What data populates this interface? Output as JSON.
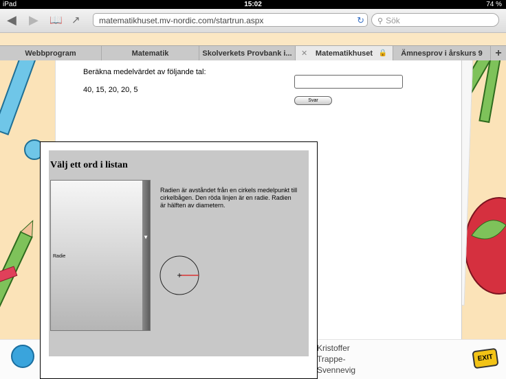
{
  "status": {
    "device": "iPad",
    "time": "15:02",
    "battery": "74 %"
  },
  "browser": {
    "url": "matematikhuset.mv-nordic.com/startrun.aspx",
    "search_placeholder": "Sök",
    "tabs": [
      {
        "label": "Webbprogram"
      },
      {
        "label": "Matematik"
      },
      {
        "label": "Skolverkets Provbank i..."
      },
      {
        "label": "Matematikhuset"
      },
      {
        "label": "Ämnesprov i årskurs 9"
      }
    ]
  },
  "exercise": {
    "question": "Beräkna medelvärdet av följande tal:",
    "numbers": "40, 15, 20, 20, 5",
    "answer_value": "",
    "answer_button": "Svar"
  },
  "popup": {
    "title": "Välj ett ord i listan",
    "list_items": [
      "Radie"
    ],
    "explanation": "Radien är avståndet från en cirkels medelpunkt till cirkelbågen. Den röda linjen är en radie. Radien är hälften av diametern."
  },
  "footer": {
    "creator_line1": "Kristoffer",
    "creator_line2": "Trappe-",
    "creator_line3": "Svennevig",
    "exit_label": "EXIT"
  },
  "icons": {
    "back": "back-arrow-icon",
    "forward": "forward-arrow-icon",
    "bookmarks": "book-icon",
    "share": "share-icon",
    "reload": "reload-icon",
    "search": "magnifier-icon",
    "lock": "lock-icon",
    "close_tab": "close-icon",
    "new_tab": "plus-icon"
  },
  "colors": {
    "circle_radius_line": "#d93030",
    "exit_badge": "#f2c316",
    "smiley": "#3aa4dc"
  }
}
